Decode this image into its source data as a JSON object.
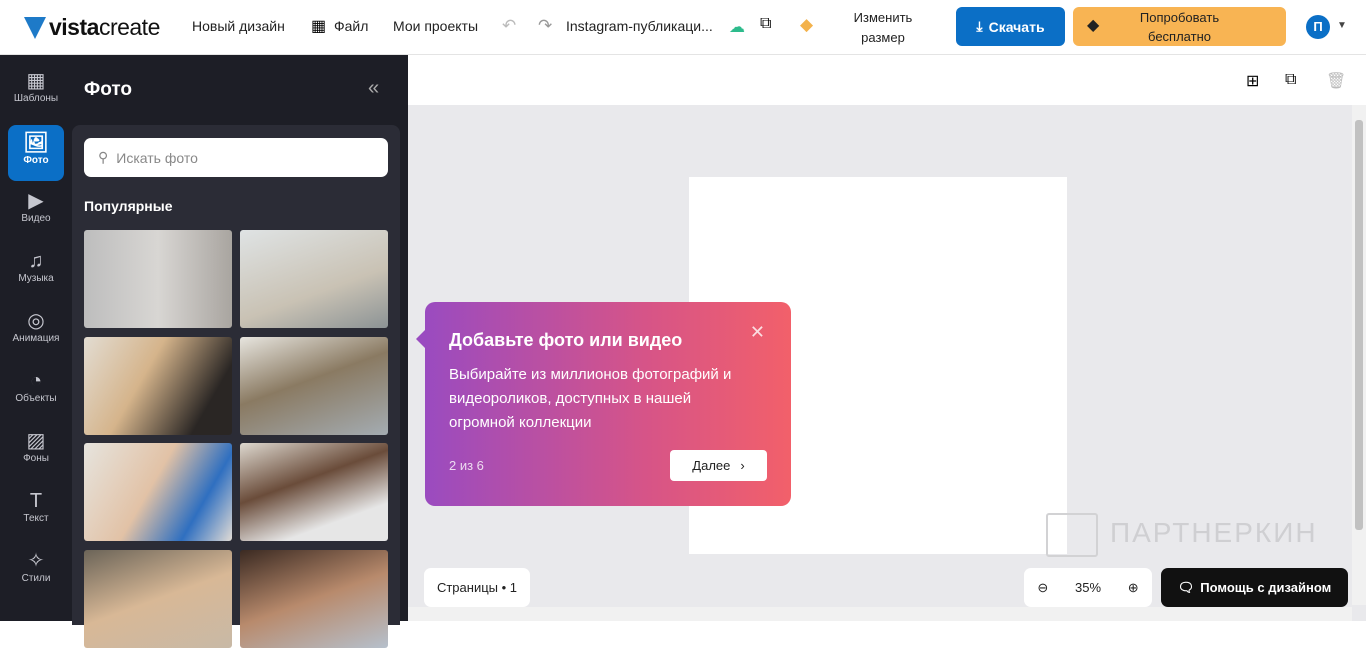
{
  "header": {
    "logo_bold": "vista",
    "logo_light": "create",
    "new_design": "Новый дизайн",
    "file": "Файл",
    "my_projects": "Мои проекты",
    "doc_title": "Instagram-публикаци...",
    "resize": "Изменить размер",
    "download": "Скачать",
    "try_free": "Попробовать бесплатно",
    "avatar": "П"
  },
  "rail": [
    {
      "label": "Шаблоны",
      "icon": "▦"
    },
    {
      "label": "Фото",
      "icon": "🖼"
    },
    {
      "label": "Видео",
      "icon": "▶"
    },
    {
      "label": "Музыка",
      "icon": "♫"
    },
    {
      "label": "Анимация",
      "icon": "◎"
    },
    {
      "label": "Объекты",
      "icon": "◔"
    },
    {
      "label": "Фоны",
      "icon": "▨"
    },
    {
      "label": "Текст",
      "icon": "T"
    },
    {
      "label": "Стили",
      "icon": "✧"
    }
  ],
  "panel": {
    "title": "Фото",
    "search_placeholder": "Искать фото",
    "section": "Популярные"
  },
  "tooltip": {
    "title": "Добавьте фото или видео",
    "body": "Выбирайте из миллионов фотографий и видеороликов, доступных в нашей огромной коллекции",
    "counter": "2 из 6",
    "next": "Далее"
  },
  "bottom": {
    "pages": "Страницы • 1",
    "zoom": "35%",
    "help": "Помощь с дизайном"
  },
  "watermark": "ПАРТНЕРКИН",
  "colors": {
    "accent": "#0b6fc6",
    "try": "#f8b453",
    "dark": "#1d1e26"
  }
}
